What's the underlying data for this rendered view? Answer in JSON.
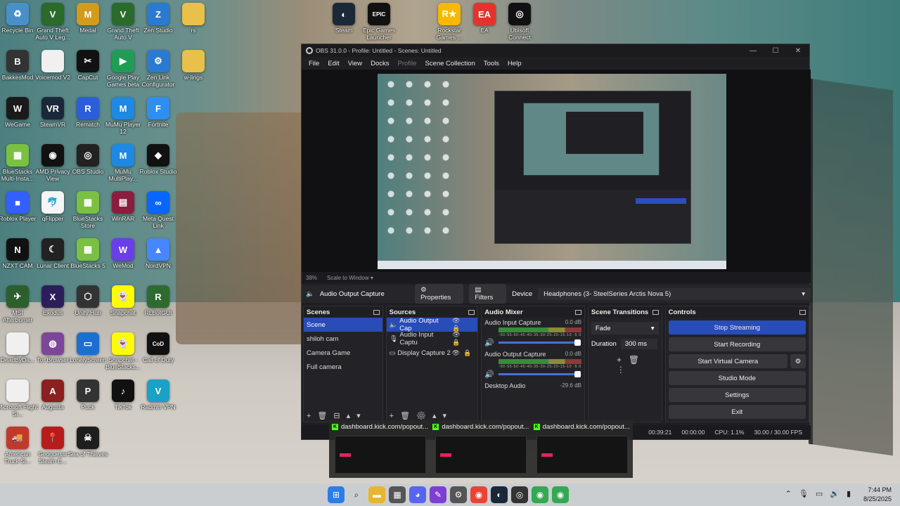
{
  "desktop": {
    "icons": [
      {
        "label": "Recycle Bin",
        "icon": "recycle-bin-icon",
        "color": "#4a90c8",
        "glyph": "♻"
      },
      {
        "label": "Grand Theft Auto V Leg...",
        "icon": "gta-icon",
        "color": "#2a6a2a",
        "glyph": "V"
      },
      {
        "label": "Medal",
        "icon": "medal-icon",
        "color": "#d39b1d",
        "glyph": "M"
      },
      {
        "label": "Grand Theft Auto V",
        "icon": "gta-icon",
        "color": "#2a6a2a",
        "glyph": "V"
      },
      {
        "label": "Zen Studio",
        "icon": "zen-studio-icon",
        "color": "#2a7ad1",
        "glyph": "Z"
      },
      {
        "label": "rs",
        "icon": "folder-icon",
        "color": "#e8c04a",
        "glyph": ""
      },
      {
        "label": "BakkesMod",
        "icon": "bakkesmod-icon",
        "color": "#333333",
        "glyph": "B"
      },
      {
        "label": "Voicemod V2",
        "icon": "file-icon",
        "color": "#f0f0f0",
        "glyph": ""
      },
      {
        "label": "CapCut",
        "icon": "capcut-icon",
        "color": "#111111",
        "glyph": "✂"
      },
      {
        "label": "Google Play Games beta",
        "icon": "google-play-icon",
        "color": "#1f9d55",
        "glyph": "▶"
      },
      {
        "label": "Zen Link Configurator",
        "icon": "zen-link-icon",
        "color": "#2a7ad1",
        "glyph": "⚙"
      },
      {
        "label": "w-lings",
        "icon": "folder-icon",
        "color": "#e8c04a",
        "glyph": ""
      },
      {
        "label": "WeGame",
        "icon": "wegame-icon",
        "color": "#1a1a1a",
        "glyph": "W"
      },
      {
        "label": "SteamVR",
        "icon": "steamvr-icon",
        "color": "#1b2838",
        "glyph": "VR"
      },
      {
        "label": "Rematch",
        "icon": "rematch-icon",
        "color": "#2b5fd9",
        "glyph": "R"
      },
      {
        "label": "MuMu Player 12",
        "icon": "mumu-icon",
        "color": "#1e88e5",
        "glyph": "M"
      },
      {
        "label": "Fortnite",
        "icon": "fortnite-icon",
        "color": "#2f8ff0",
        "glyph": "F"
      },
      {
        "label": "BlueStacks Multi-Insta...",
        "icon": "bluestacks-icon",
        "color": "#7bc043",
        "glyph": "▦"
      },
      {
        "label": "AMD Privacy View",
        "icon": "amd-icon",
        "color": "#111111",
        "glyph": "◉"
      },
      {
        "label": "OBS Studio",
        "icon": "obs-icon",
        "color": "#222222",
        "glyph": "◎"
      },
      {
        "label": "MuMu MultiPlay...",
        "icon": "mumu-icon",
        "color": "#1e88e5",
        "glyph": "M"
      },
      {
        "label": "Roblox Studio",
        "icon": "roblox-studio-icon",
        "color": "#111111",
        "glyph": "◆"
      },
      {
        "label": "Roblox Player",
        "icon": "roblox-icon",
        "color": "#335fff",
        "glyph": "■"
      },
      {
        "label": "qFlipper",
        "icon": "qflipper-icon",
        "color": "#f5f5f5",
        "glyph": "🐬"
      },
      {
        "label": "BlueStacks Store",
        "icon": "bluestacks-icon",
        "color": "#7bc043",
        "glyph": "▦"
      },
      {
        "label": "WinRAR",
        "icon": "winrar-icon",
        "color": "#8b1e3f",
        "glyph": "▤"
      },
      {
        "label": "Meta Quest Link",
        "icon": "meta-icon",
        "color": "#0866ff",
        "glyph": "∞"
      },
      {
        "label": "NZXT CAM",
        "icon": "nzxt-icon",
        "color": "#111111",
        "glyph": "N"
      },
      {
        "label": "Lunar Client",
        "icon": "lunar-client-icon",
        "color": "#222222",
        "glyph": "☾"
      },
      {
        "label": "BlueStacks 5",
        "icon": "bluestacks-icon",
        "color": "#7bc043",
        "glyph": "▦"
      },
      {
        "label": "WeMod",
        "icon": "wemod-icon",
        "color": "#6a3ee8",
        "glyph": "W"
      },
      {
        "label": "NordVPN",
        "icon": "nordvpn-icon",
        "color": "#4687ff",
        "glyph": "▲"
      },
      {
        "label": "MSI Afterburner",
        "icon": "msi-icon",
        "color": "#2d5f2d",
        "glyph": "✈"
      },
      {
        "label": "Exodus",
        "icon": "exodus-icon",
        "color": "#2b1e5a",
        "glyph": "X"
      },
      {
        "label": "Unity Hub",
        "icon": "unity-icon",
        "color": "#333333",
        "glyph": "⬡"
      },
      {
        "label": "Snapchat",
        "icon": "snapchat-icon",
        "color": "#fffc00",
        "glyph": "👻"
      },
      {
        "label": "RLBotGUI",
        "icon": "rlbot-icon",
        "color": "#2e6b2e",
        "glyph": "R"
      },
      {
        "label": "DeadByDa...",
        "icon": "file-icon",
        "color": "#f0f0f0",
        "glyph": ""
      },
      {
        "label": "Tor Browser",
        "icon": "tor-icon",
        "color": "#7d4698",
        "glyph": "◍"
      },
      {
        "label": "LonelyScreen",
        "icon": "lonelyscreen-icon",
        "color": "#1c6fd1",
        "glyph": "▭"
      },
      {
        "label": "Snapchat - BlueStacks...",
        "icon": "snapchat-icon",
        "color": "#fffc00",
        "glyph": "👻"
      },
      {
        "label": "Call of Duty",
        "icon": "cod-icon",
        "color": "#111111",
        "glyph": "CoD"
      },
      {
        "label": "Microsoft Flight Si...",
        "icon": "file-icon",
        "color": "#f0f0f0",
        "glyph": ""
      },
      {
        "label": "Augusta",
        "icon": "augusta-icon",
        "color": "#8b2020",
        "glyph": "A"
      },
      {
        "label": "Puck",
        "icon": "puck-icon",
        "color": "#333333",
        "glyph": "P"
      },
      {
        "label": "TikTok",
        "icon": "tiktok-icon",
        "color": "#111111",
        "glyph": "♪"
      },
      {
        "label": "Radmin VPN",
        "icon": "radmin-icon",
        "color": "#19a2c7",
        "glyph": "V"
      },
      {
        "label": "American Truck Si...",
        "icon": "ats-icon",
        "color": "#c0392b",
        "glyph": "🚚"
      },
      {
        "label": "Geoguessr Steam E...",
        "icon": "geoguessr-icon",
        "color": "#b71c1c",
        "glyph": "📍"
      },
      {
        "label": "Sea of Thieves",
        "icon": "sea-of-thieves-icon",
        "color": "#1e1e1e",
        "glyph": "☠"
      },
      {
        "label": "Steam",
        "icon": "steam-icon",
        "color": "#1b2838",
        "glyph": "◐"
      },
      {
        "label": "Epic Games Launcher",
        "icon": "epic-icon",
        "color": "#111111",
        "glyph": "EPIC"
      },
      {
        "label": "Rockstar Games ...",
        "icon": "rockstar-icon",
        "color": "#f7b800",
        "glyph": "R★"
      },
      {
        "label": "EA",
        "icon": "ea-icon",
        "color": "#e5322c",
        "glyph": "EA"
      },
      {
        "label": "Ubisoft Connect",
        "icon": "ubisoft-icon",
        "color": "#111111",
        "glyph": "◎"
      }
    ]
  },
  "obs": {
    "title": "OBS 31.0.0 - Profile: Untitled - Scenes: Untitled",
    "menu": [
      "File",
      "Edit",
      "View",
      "Docks",
      "Profile",
      "Scene Collection",
      "Tools",
      "Help"
    ],
    "zoom": {
      "percent": "38%",
      "mode": "Scale to Window"
    },
    "source_bar": {
      "selected_source": "Audio Output Capture",
      "properties": "Properties",
      "filters": "Filters",
      "device_label": "Device",
      "device_value": "Headphones (3- SteelSeries Arctis Nova 5)"
    },
    "scenes": {
      "header": "Scenes",
      "items": [
        "Scene",
        "shiloh cam",
        "Camera Game",
        "Full camera"
      ],
      "selected": 0
    },
    "sources": {
      "header": "Sources",
      "items": [
        "Audio Output Cap",
        "Audio Input Captu",
        "Display Capture 2"
      ]
    },
    "mixer": {
      "header": "Audio Mixer",
      "channels": [
        {
          "name": "Audio Input Capture",
          "db": "0.0 dB"
        },
        {
          "name": "Audio Output Capture",
          "db": "0.0 dB"
        },
        {
          "name": "Desktop Audio",
          "db": "-29.6 dB"
        }
      ],
      "ticks": "-60-55-50-45-40-35-30-25-20-15-10 -5 0"
    },
    "transitions": {
      "header": "Scene Transitions",
      "type": "Fade",
      "duration_label": "Duration",
      "duration_value": "300 ms"
    },
    "controls": {
      "header": "Controls",
      "stop_streaming": "Stop Streaming",
      "start_recording": "Start Recording",
      "start_virtual_camera": "Start Virtual Camera",
      "studio_mode": "Studio Mode",
      "settings": "Settings",
      "exit": "Exit"
    },
    "status": {
      "live_time": "00:39:21",
      "rec_time": "00:00:00",
      "cpu": "CPU: 1.1%",
      "fps": "30.00 / 30.00 FPS"
    }
  },
  "thumbnails": [
    {
      "title": "dashboard.kick.com/popout..."
    },
    {
      "title": "dashboard.kick.com/popout..."
    },
    {
      "title": "dashboard.kick.com/popout..."
    }
  ],
  "taskbar": {
    "time": "7:44 PM",
    "date": "8/25/2025"
  },
  "colors": {
    "accent": "#284cb8",
    "kick_green": "#53fc18"
  }
}
